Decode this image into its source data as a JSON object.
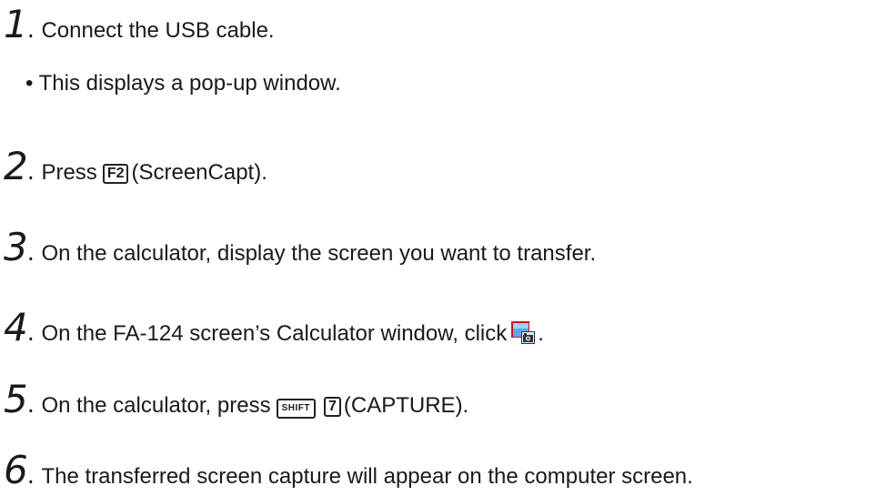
{
  "steps": [
    {
      "num": "1",
      "text": "Connect the USB cable."
    },
    {
      "num": "2",
      "pre": "Press",
      "key": "F2",
      "post": "(ScreenCapt)."
    },
    {
      "num": "3",
      "text": "On the calculator, display the screen you want to transfer."
    },
    {
      "num": "4",
      "pre": "On the FA-124 screen’s Calculator window, click",
      "post": "."
    },
    {
      "num": "5",
      "pre": "On the calculator, press",
      "key1": "SHIFT",
      "key2": "7",
      "post": "(CAPTURE)."
    },
    {
      "num": "6",
      "text": "The transferred screen capture will appear on the computer screen."
    }
  ],
  "bullet_1": "• This displays a pop-up window.",
  "icons": {
    "capture": "screen-capture-icon"
  },
  "colors": {
    "text": "#1a1a1a",
    "icon_red": "#d0121b",
    "icon_blue": "#2f8fd8"
  }
}
